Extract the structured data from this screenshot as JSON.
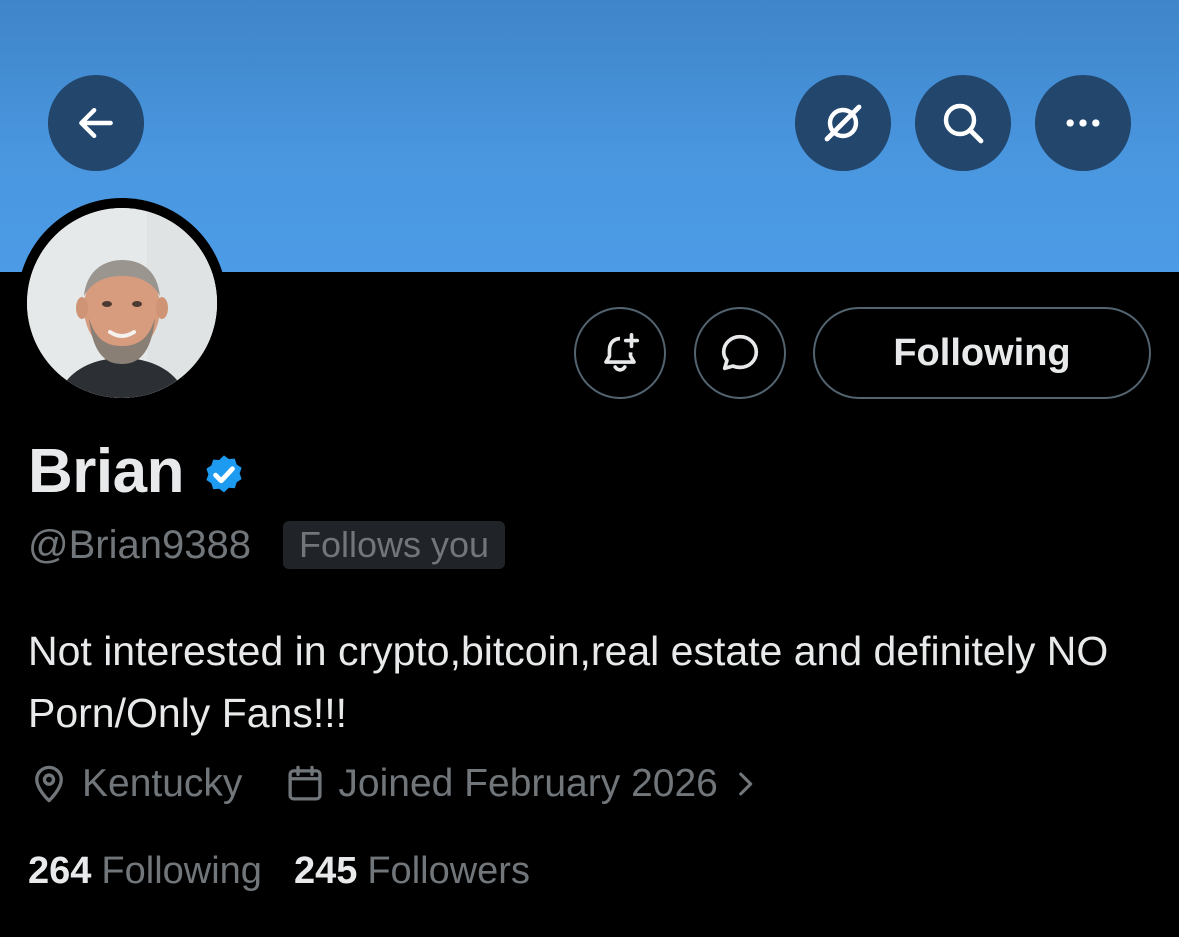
{
  "profile": {
    "display_name": "Brian",
    "handle": "@Brian9388",
    "follows_you_badge": "Follows you",
    "bio": "Not interested in crypto,bitcoin,real estate and definitely NO Porn/Only Fans!!!",
    "location": "Kentucky",
    "joined": "Joined February 2026",
    "following_count": "264",
    "following_label": "Following",
    "followers_count": "245",
    "followers_label": "Followers"
  },
  "actions": {
    "follow_state_label": "Following"
  },
  "icons": {
    "back": "arrow-left-icon",
    "grok": "grok-icon",
    "search": "search-icon",
    "more": "more-dots-icon",
    "notify": "bell-plus-icon",
    "message": "message-bubble-icon",
    "verified": "verified-badge-icon",
    "location": "location-pin-icon",
    "calendar": "calendar-icon",
    "chevron": "chevron-right-icon"
  },
  "colors": {
    "banner": "#4a97e0",
    "nav_button": "#22466c",
    "verified": "#1d9bf0",
    "background": "#000000",
    "muted_text": "#71767b"
  }
}
